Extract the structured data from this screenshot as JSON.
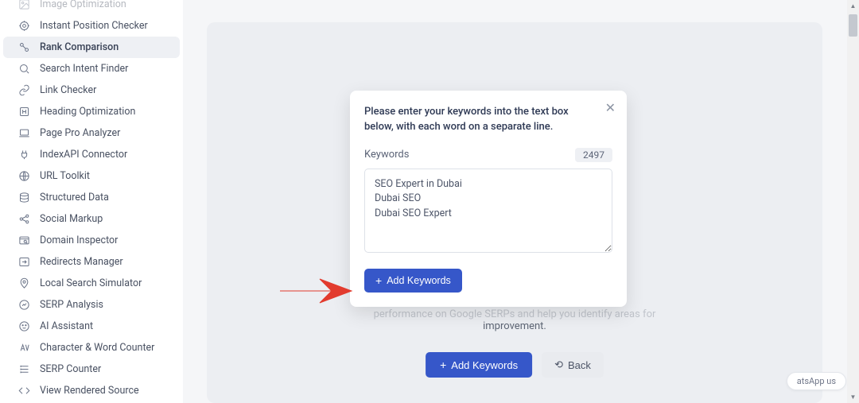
{
  "sidebar": {
    "items": [
      {
        "label": "Image Optimization"
      },
      {
        "label": "Instant Position Checker"
      },
      {
        "label": "Rank Comparison"
      },
      {
        "label": "Search Intent Finder"
      },
      {
        "label": "Link Checker"
      },
      {
        "label": "Heading Optimization"
      },
      {
        "label": "Page Pro Analyzer"
      },
      {
        "label": "IndexAPI Connector"
      },
      {
        "label": "URL Toolkit"
      },
      {
        "label": "Structured Data"
      },
      {
        "label": "Social Markup"
      },
      {
        "label": "Domain Inspector"
      },
      {
        "label": "Redirects Manager"
      },
      {
        "label": "Local Search Simulator"
      },
      {
        "label": "SERP Analysis"
      },
      {
        "label": "AI Assistant"
      },
      {
        "label": "Character & Word Counter"
      },
      {
        "label": "SERP Counter"
      },
      {
        "label": "View Rendered Source"
      }
    ],
    "active_index": 2
  },
  "modal": {
    "instruction": "Please enter your keywords into the text box below, with each word on a separate line.",
    "keywords_label": "Keywords",
    "count": "2497",
    "textarea_value": "SEO Expert in Dubai\nDubai SEO\nDubai SEO Expert",
    "add_button": "Add Keywords"
  },
  "main": {
    "description_tail": "improvement.",
    "add_keywords": "Add Keywords",
    "back": "Back"
  },
  "footer": {
    "whatsapp": "atsApp us"
  }
}
